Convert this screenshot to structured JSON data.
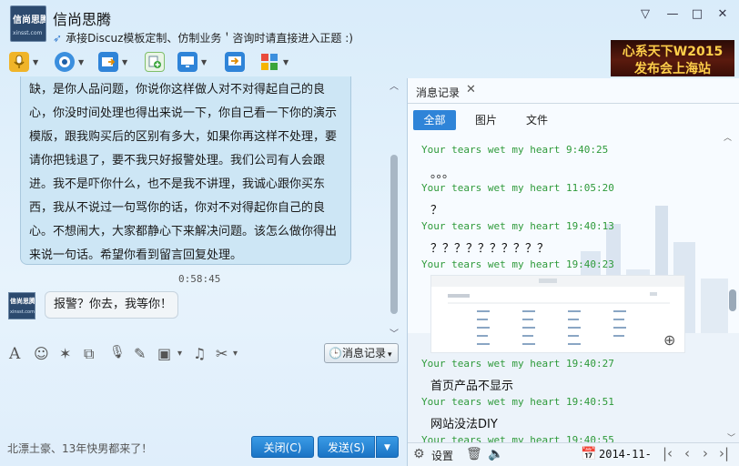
{
  "window": {
    "title": "信尚思腾",
    "signature": "承接Discuz模板定制、仿制业务＇咨询时请直接进入正题 :)",
    "avatar_line1": "信尚思腾",
    "avatar_line2": "xinsst.com",
    "controls": [
      "▽",
      "—",
      "□",
      "✕"
    ]
  },
  "banner": {
    "line1": "心系天下W2015",
    "line2": "发布会上海站"
  },
  "toolbar": {
    "items": [
      {
        "icon": "microphone-icon"
      },
      {
        "icon": "webcam-icon"
      },
      {
        "icon": "send-file-icon"
      },
      {
        "icon": "add-contact-icon"
      },
      {
        "icon": "remote-desktop-icon"
      },
      {
        "icon": "share-screen-icon"
      },
      {
        "icon": "apps-icon"
      }
    ]
  },
  "chat": {
    "message_lines": [
      "缺，是你人品问题，你说你这样做人对不对得起自己的良",
      "心，你没时间处理也得出来说一下，你自己看一下你的演示",
      "模版，跟我购买后的区别有多大，如果你再这样不处理，要",
      "请你把钱退了，要不我只好报警处理。我们公司有人会跟",
      "进。我不是吓你什么，也不是我不讲理，我诚心跟你买东",
      "西，我从不说过一句骂你的话，你对不对得起你自己的良",
      "心。不想闹大，大家都静心下来解决问题。该怎么做你得出",
      "来说一句话。希望你看到留言回复处理。"
    ],
    "time": "0:58:45",
    "self_message": "报警？你去，我等你！",
    "self_avatar_line1": "信尚思腾",
    "self_avatar_line2": "xinsst.com"
  },
  "edit_toolbar": {
    "history_label": "消息记录",
    "font_glyph": "A",
    "emoji_glyph": "☺",
    "poke_glyph": "✶",
    "clip_glyph": "⧉",
    "voice_glyph": "🎙",
    "edit_glyph": "✎",
    "image_glyph": "▣",
    "music_glyph": "♫",
    "cut_glyph": "✂",
    "caret": "▾"
  },
  "footer": {
    "status": "北漂土豪、13年快男都来了！",
    "close_label": "关闭(C)",
    "send_label": "发送(S)",
    "send_dropdown": "▼"
  },
  "history": {
    "tab_label": "消息记录",
    "filters": [
      "全部",
      "图片",
      "文件"
    ],
    "entries": [
      {
        "head": "Your tears wet my heart 9:40:25",
        "body": "。。。"
      },
      {
        "head": "Your tears wet my heart 11:05:20",
        "body": "？"
      },
      {
        "head": "Your tears wet my heart 19:40:13",
        "body": "？？？？？？？？？？"
      },
      {
        "head": "Your tears wet my heart 19:40:23",
        "body": ""
      },
      {
        "head": "Your tears wet my heart 19:40:27",
        "body": "首页产品不显示"
      },
      {
        "head": "Your tears wet my heart 19:40:51",
        "body": "网站没法DIY"
      },
      {
        "head": "Your tears wet my heart 19:40:55",
        "body": ""
      }
    ],
    "footer_settings": "设置",
    "footer_date": "2014-11-",
    "nav": [
      "|‹",
      "‹",
      "›",
      "›|"
    ]
  },
  "colors": {
    "accent_blue": "#2f84d8",
    "timestamp_green": "#2e9a3a",
    "bubble_blue": "#cde6f5"
  }
}
